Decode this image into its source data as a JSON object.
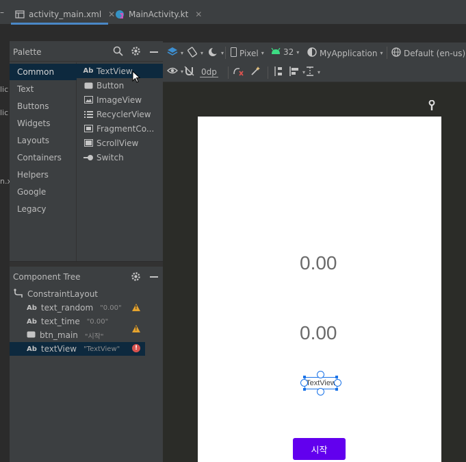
{
  "tabs": [
    {
      "label": "activity_main.xml",
      "icon": "layout-xml-icon",
      "active": true
    },
    {
      "label": "MainActivity.kt",
      "icon": "kotlin-class-icon",
      "active": false
    }
  ],
  "left_strip": [
    "lic",
    "lic",
    "n.x"
  ],
  "palette": {
    "title": "Palette",
    "categories": [
      "Common",
      "Text",
      "Buttons",
      "Widgets",
      "Layouts",
      "Containers",
      "Helpers",
      "Google",
      "Legacy"
    ],
    "selected_category": "Common",
    "items": [
      {
        "label": "TextView",
        "icon": "Ab"
      },
      {
        "label": "Button",
        "icon": "button-icon"
      },
      {
        "label": "ImageView",
        "icon": "image-icon"
      },
      {
        "label": "RecyclerView",
        "icon": "list-icon"
      },
      {
        "label": "FragmentCo...",
        "icon": "fragment-icon"
      },
      {
        "label": "ScrollView",
        "icon": "scroll-icon"
      },
      {
        "label": "Switch",
        "icon": "switch-icon"
      }
    ]
  },
  "component_tree": {
    "title": "Component Tree",
    "root": "ConstraintLayout",
    "children": [
      {
        "id": "text_random",
        "value": "\"0.00\"",
        "icon": "Ab",
        "status": "warning"
      },
      {
        "id": "text_time",
        "value": "\"0.00\"",
        "icon": "Ab",
        "status": "warning"
      },
      {
        "id": "btn_main",
        "value": "\"시작\"",
        "icon": "button-icon",
        "status": "warning"
      },
      {
        "id": "textView",
        "value": "\"TextView\"",
        "icon": "Ab",
        "status": "error"
      }
    ]
  },
  "toolbar": {
    "device": "Pixel",
    "api": "32",
    "theme": "MyApplication",
    "locale": "Default (en-us)",
    "margin": "0dp"
  },
  "preview": {
    "text_random": "0.00",
    "text_time": "0.00",
    "text_view": "TextView",
    "button": "시작"
  },
  "colors": {
    "selection": "#0d293e",
    "accent_blue": "#4a88c7",
    "button_purple": "#6200ee",
    "warning": "#e5a32e",
    "error": "#d9534f"
  }
}
